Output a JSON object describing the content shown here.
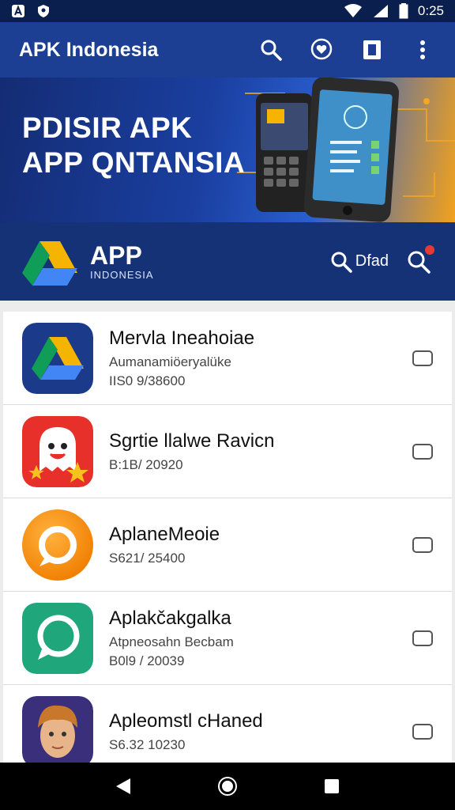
{
  "status_bar": {
    "time": "0:25"
  },
  "app_bar": {
    "title": "APK Indonesia"
  },
  "banner": {
    "line1": "PDISIR APK",
    "line2": "APP QNTANSIA"
  },
  "brand": {
    "name": "APP",
    "subtitle": "INDONESIA",
    "find_label": "Dfad"
  },
  "apps": [
    {
      "name": "Mervla Ineahoiae",
      "desc": "Aumanamiöeryalüke",
      "meta": "IIS0 9/38600",
      "icon": "drive-logo-icon"
    },
    {
      "name": "Sgrtie llalwe Ravicn",
      "desc": "",
      "meta": "B:1B/ 20920",
      "icon": "ghost-star-icon"
    },
    {
      "name": "AplaneMeoie",
      "desc": "",
      "meta": "S621/ 25400",
      "icon": "orange-ring-icon"
    },
    {
      "name": "Aplakčakgalka",
      "desc": "Atpneosahn Becbam",
      "meta": "B0l9 / 20039",
      "icon": "chat-bubble-icon"
    },
    {
      "name": "Apleomstl cHaned",
      "desc": "",
      "meta": "S6.32 10230",
      "icon": "avatar-face-icon"
    }
  ],
  "colors": {
    "app_bar": "#1c3f94",
    "status_bar": "#0b1f4f",
    "brand_strip": "#143275"
  }
}
